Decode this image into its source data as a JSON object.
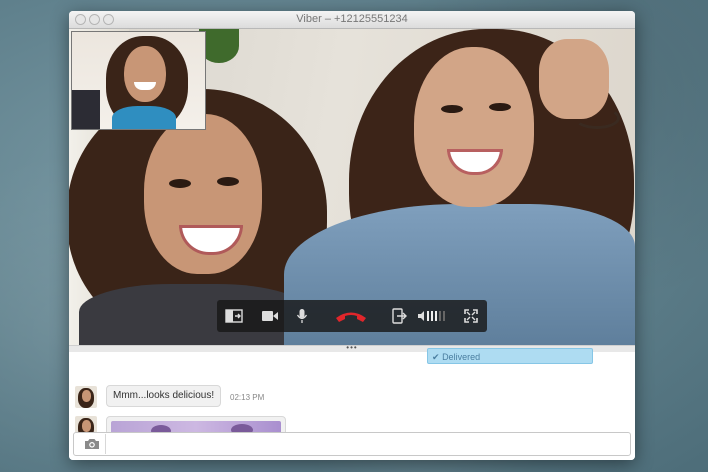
{
  "window": {
    "title": "Viber – +12125551234"
  },
  "video_call": {
    "controls": [
      {
        "name": "swap-camera-icon"
      },
      {
        "name": "video-camera-icon"
      },
      {
        "name": "microphone-icon"
      },
      {
        "name": "end-call-icon",
        "color": "#e0262b"
      },
      {
        "name": "transfer-call-icon"
      },
      {
        "name": "volume-icon"
      },
      {
        "name": "fullscreen-icon"
      }
    ]
  },
  "chat": {
    "delivered_status": "Delivered",
    "messages": [
      {
        "text": "Mmm...looks delicious!",
        "time": "02:13 PM"
      }
    ]
  },
  "composer": {
    "camera_icon": "camera-icon"
  },
  "colors": {
    "delivered_bg": "#aedcf2",
    "end_call": "#e0262b",
    "accent_pink": "#c8a8d8"
  }
}
